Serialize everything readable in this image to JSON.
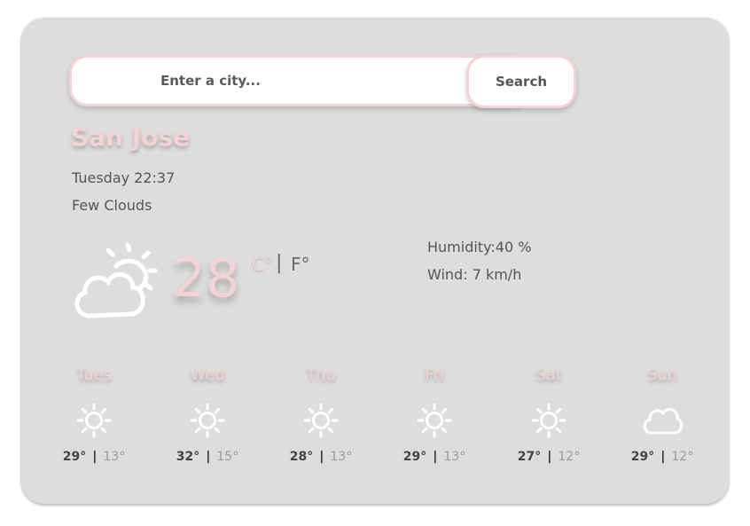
{
  "search": {
    "placeholder": "Enter a city...",
    "button_label": "Search"
  },
  "current": {
    "city": "San Jose",
    "datetime": "Tuesday 22:37",
    "description": "Few Clouds",
    "icon": "few-clouds-icon",
    "temperature": "28",
    "unit_celsius": "C°",
    "unit_separator": "|",
    "unit_fahrenheit": "F°",
    "humidity": "Humidity:40 %",
    "wind": "Wind: 7 km/h"
  },
  "forecast": [
    {
      "day": "Tues",
      "icon": "sun-icon",
      "max": "29°",
      "min": "13°"
    },
    {
      "day": "Wed",
      "icon": "sun-icon",
      "max": "32°",
      "min": "15°"
    },
    {
      "day": "Thu",
      "icon": "sun-icon",
      "max": "28°",
      "min": "13°"
    },
    {
      "day": "Fri",
      "icon": "sun-icon",
      "max": "29°",
      "min": "13°"
    },
    {
      "day": "Sat",
      "icon": "sun-icon",
      "max": "27°",
      "min": "12°"
    },
    {
      "day": "Sun",
      "icon": "cloud-icon",
      "max": "29°",
      "min": "12°"
    }
  ],
  "temp_separator": "|",
  "colors": {
    "card_background": "#dddddd",
    "accent_pink": "#f3d3d3",
    "text_dark": "#555555",
    "text_muted": "#9a9a9a",
    "icon_white": "#ffffff"
  }
}
